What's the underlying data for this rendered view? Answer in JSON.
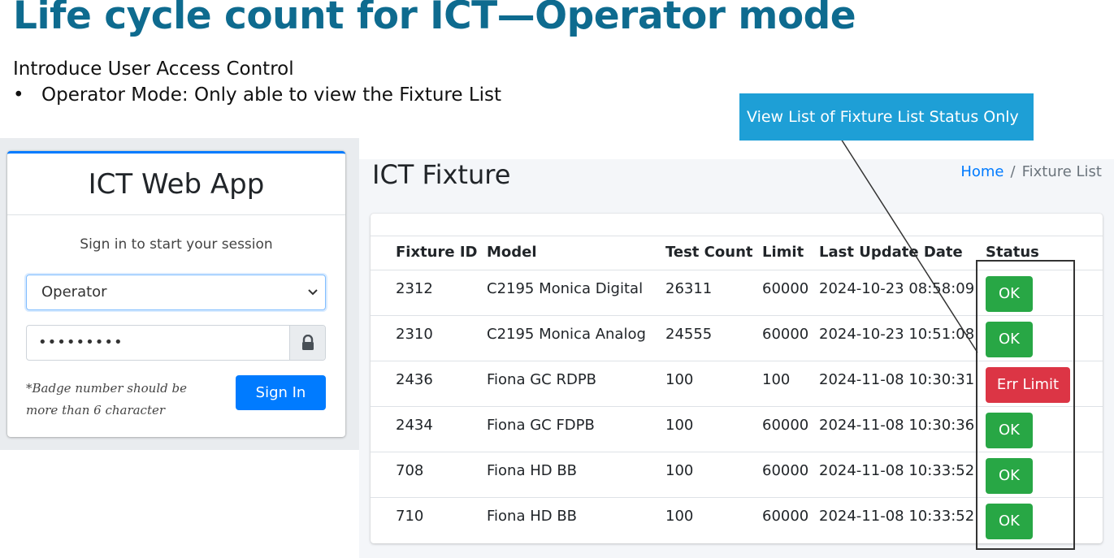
{
  "slide": {
    "title": "Life cycle count for ICT—Operator mode",
    "intro": "Introduce User Access Control",
    "bullet": "Operator Mode: Only able to view the Fixture List"
  },
  "login": {
    "app_title": "ICT Web App",
    "message": "Sign in to start your session",
    "role_selected": "Operator",
    "password_mask": "•••••••••",
    "hint": "*Badge number should be more than 6 character",
    "signin_label": "Sign In",
    "accent_color": "#007bff"
  },
  "fixture_page": {
    "title": "ICT Fixture",
    "breadcrumb": {
      "home": "Home",
      "separator": "/",
      "current": "Fixture List"
    },
    "columns": [
      "Fixture ID",
      "Model",
      "Test Count",
      "Limit",
      "Last Update Date",
      "Status"
    ],
    "rows": [
      {
        "id": "2312",
        "model": "C2195 Monica Digital",
        "count": "26311",
        "limit": "60000",
        "date": "2024-10-23 08:58:09",
        "status": "OK",
        "status_type": "ok"
      },
      {
        "id": "2310",
        "model": "C2195 Monica Analog",
        "count": "24555",
        "limit": "60000",
        "date": "2024-10-23 10:51:08",
        "status": "OK",
        "status_type": "ok"
      },
      {
        "id": "2436",
        "model": "Fiona GC RDPB",
        "count": "100",
        "limit": "100",
        "date": "2024-11-08 10:30:31",
        "status": "Err Limit",
        "status_type": "err"
      },
      {
        "id": "2434",
        "model": "Fiona GC FDPB",
        "count": "100",
        "limit": "60000",
        "date": "2024-11-08 10:30:36",
        "status": "OK",
        "status_type": "ok"
      },
      {
        "id": "708",
        "model": "Fiona HD BB",
        "count": "100",
        "limit": "60000",
        "date": "2024-11-08 10:33:52",
        "status": "OK",
        "status_type": "ok"
      },
      {
        "id": "710",
        "model": "Fiona HD BB",
        "count": "100",
        "limit": "60000",
        "date": "2024-11-08 10:33:52",
        "status": "OK",
        "status_type": "ok"
      }
    ],
    "colors": {
      "ok": "#28a745",
      "err": "#dc3545",
      "link": "#007bff"
    }
  },
  "callout": {
    "text": "View List of Fixture List Status Only",
    "color": "#1e9fd6"
  },
  "icons": {
    "lock": "lock-icon",
    "chevron": "chevron-down-icon"
  }
}
